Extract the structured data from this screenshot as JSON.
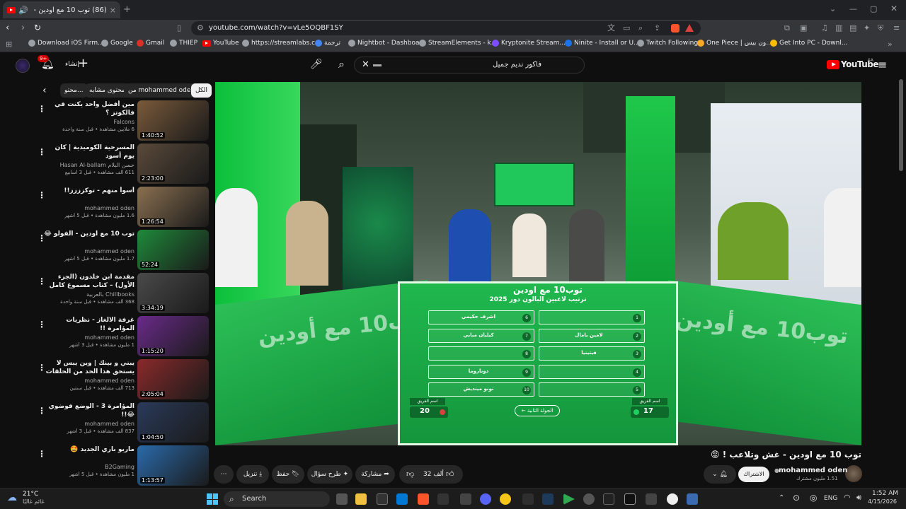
{
  "browser": {
    "tab_title": "(86) توب 10 مع اودين - غش وتلا…",
    "url": "youtube.com/watch?v=vLe5OQBF1SY",
    "bookmarks": [
      "Download iOS Firm...",
      "Google",
      "Gmail",
      "THIEP",
      "YouTube",
      "https://streamlabs.c...",
      "ترجمة",
      "Nightbot - Dashboa...",
      "StreamElements - k...",
      "Kryptonite Stream...",
      "Ninite - Install or U...",
      "Twitch Following",
      "One Piece | ون بيس...",
      "Get Into PC - Downl..."
    ],
    "icon_colors": {
      "yt_red": "#ff0000",
      "brave": "#fb542b"
    }
  },
  "yt_header": {
    "logo_text": "YouTube",
    "logo_sup": "SA",
    "search_value": "فاكور نديم جميل",
    "create_label": "إنشاء",
    "notification_count": "9+"
  },
  "sidebar": {
    "chips": [
      "الكل",
      "من mohammed oden",
      "محتوى مشابه",
      "محتو..."
    ],
    "videos": [
      {
        "title": "مين أفضل واحد يكنت في فالكونز ؟",
        "channel": "Falcons",
        "meta": "6 ملايين مشاهدة • قبل سنة واحدة",
        "duration": "1:40:52",
        "color": "#7a5a3a"
      },
      {
        "title": "المسرحية الكوميدية | كان يوم أسود",
        "channel": "حسن البلام Hasan Al-ballam",
        "meta": "611 ألف مشاهدة • قبل 3 أسابيع",
        "duration": "2:23:00",
        "color": "#5a4a3a"
      },
      {
        "title": "أسوأ منهم - توكزززز!!",
        "channel": "mohammed oden",
        "meta": "1.6 مليون مشاهدة • قبل 5 أشهر",
        "duration": "1:26:54",
        "color": "#8a7050"
      },
      {
        "title": "توب 10 مع اودين - الفولو 😂",
        "channel": "mohammed oden",
        "meta": "1.7 مليون مشاهدة • قبل 5 أشهر",
        "duration": "52:24",
        "color": "#1f8a3a"
      },
      {
        "title": "مقدمة ابن خلدون (الجزء الأول) – كتاب مسموع كامل مع النص (كابتر)",
        "channel": "Chillbooks بالعربية",
        "meta": "368 ألف مشاهدة • قبل سنة واحدة",
        "duration": "3:34:19",
        "color": "#4a4a4a"
      },
      {
        "title": "غرفة الالغاز - نظريات المؤامرة !!",
        "channel": "mohammed oden",
        "meta": "1 مليون مشاهدة • قبل 3 أشهر",
        "duration": "1:15:20",
        "color": "#6a2a8a"
      },
      {
        "title": "يبني و بينك | وين يبس لا يستحق هذا الحد من الحلقات -- ركان الشايع",
        "channel": "mohammed oden",
        "meta": "713 ألف مشاهدة • قبل سنتين",
        "duration": "2:05:04",
        "color": "#8a2a2a"
      },
      {
        "title": "المؤامرة 3 - الوضع فوضوي 😂!!",
        "channel": "mohammed oden",
        "meta": "837 ألف مشاهدة • قبل 3 أشهر",
        "duration": "1:04:50",
        "color": "#2a3a5a"
      },
      {
        "title": "ماريو باري الجديد 🤩",
        "channel": "B2Gaming",
        "meta": "1 مليون مشاهدة • قبل 5 أشهر",
        "duration": "1:13:57",
        "color": "#2a6aaa"
      }
    ]
  },
  "player": {
    "board_title_logo": "توب10 مع اودين",
    "board_heading": "ترتيب لاعبين البالون دور 2025",
    "left_column": [
      {
        "num": "6",
        "name": "اشرف حكيمي"
      },
      {
        "num": "7",
        "name": "كيليان مبابي"
      },
      {
        "num": "8",
        "name": ""
      },
      {
        "num": "9",
        "name": "دوناروما"
      },
      {
        "num": "10",
        "name": "نونو مينديش"
      }
    ],
    "right_column": [
      {
        "num": "1",
        "name": ""
      },
      {
        "num": "2",
        "name": "لامين يامال"
      },
      {
        "num": "3",
        "name": "فيتينيا"
      },
      {
        "num": "4",
        "name": ""
      },
      {
        "num": "5",
        "name": ""
      }
    ],
    "next_round_label": "الجولة الثانية",
    "team_label_left": "اسم الفريق",
    "team_label_right": "اسم الفريق",
    "score_left": "20",
    "score_right": "17",
    "side_logo_text": "توب10 مع أودين"
  },
  "video": {
    "title": "توب 10 مع اودين - غش وتلاعب ! 😡",
    "channel": "mohammed oden",
    "subscribers": "1.51 مليون مشترك",
    "subscribe_label": "الاشتراك",
    "likes": "32 ألف",
    "share_label": "مشاركة",
    "ask_label": "طرح سؤال",
    "save_label": "حفظ",
    "download_label": "تنزيل"
  },
  "taskbar": {
    "search_placeholder": "Search",
    "weather_temp": "21°C",
    "weather_desc": "غائم غالبًا",
    "lang": "ENG",
    "time": "1:52 AM",
    "date": "4/15/2026"
  }
}
